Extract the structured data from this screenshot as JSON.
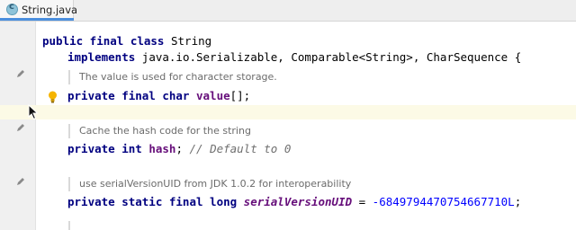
{
  "tab": {
    "label": "String.java"
  },
  "code": {
    "line1_kw": "public final class",
    "line1_name": " String",
    "line2_kw": "implements",
    "line2_rest": " java.io.Serializable, Comparable<String>, CharSequence {",
    "doc1": "The value is used for character storage.",
    "line3_kw": "private final char",
    "line3_field": " value",
    "line3_rest": "[];",
    "doc2": "Cache the hash code for the string",
    "line4_kw": "private int",
    "line4_field": " hash",
    "line4_rest": "; ",
    "line4_comment": "// Default to 0",
    "doc3": "use serialVersionUID from JDK 1.0.2 for interoperability",
    "line5_kw": "private static final long",
    "line5_const": " serialVersionUID",
    "line5_eq": " = ",
    "line5_num": "-6849794470754667710L",
    "line5_end": ";"
  },
  "colors": {
    "keyword": "#000080",
    "field": "#660e7a",
    "number": "#0000ff",
    "caret_line": "#fcfae6",
    "tab_accent": "#4b8fde"
  },
  "icons": [
    "java-class-icon",
    "pencil-icon",
    "lightbulb-icon",
    "mouse-pointer-icon"
  ]
}
